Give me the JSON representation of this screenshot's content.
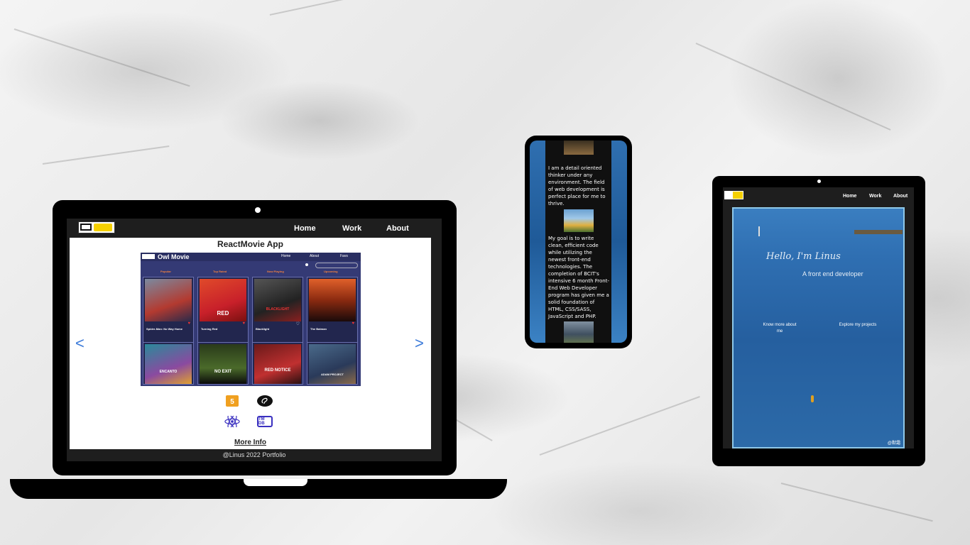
{
  "laptop": {
    "nav": {
      "home": "Home",
      "work": "Work",
      "about": "About"
    },
    "project_title": "ReactMovie App",
    "app": {
      "name": "Owl Movie",
      "nav": [
        "Home",
        "About",
        "Favs"
      ],
      "categories": [
        "Popular",
        "Top Rated",
        "Now Playing",
        "Upcoming"
      ],
      "movies_row1": [
        {
          "title": "Spider-Man: No Way Home"
        },
        {
          "title": "Turning Red",
          "poster_text": "RED"
        },
        {
          "title": "Blacklight",
          "poster_text": "BLACKLIGHT"
        },
        {
          "title": "The Batman"
        }
      ],
      "movies_row2": [
        {
          "poster_text": "ENCANTO"
        },
        {
          "poster_text": "NO EXIT"
        },
        {
          "poster_text": "RED NOTICE"
        },
        {
          "poster_text": "ADAM PROJECT"
        }
      ]
    },
    "tech_icons": [
      "html5-icon",
      "sass-icon",
      "react-icon",
      "tmdb-icon"
    ],
    "tmdb_label": "TM DB",
    "more_info": "More Info",
    "footer": "@Linus 2022 Portfolio",
    "prev_arrow": "<",
    "next_arrow": ">"
  },
  "phone": {
    "paragraph1": "I am a detail oriented thinker under any environment. The field of web development is perfect place for me to thrive.",
    "paragraph2": "My goal is to write clean, efficient code while utilizing the newest front-end technologies. The completion of BCIT's intensive 6 month Front-End Web Developer program has given me a solid foundation of HTML, CSS/SASS, JavaScript and PHP."
  },
  "tablet": {
    "nav": {
      "home": "Home",
      "work": "Work",
      "about": "About"
    },
    "greeting": "Hello, I'm Linus",
    "subtitle": "A front end developer",
    "button_about": "Know more about me",
    "button_projects": "Explore my projects",
    "watermark": "@默霜"
  }
}
